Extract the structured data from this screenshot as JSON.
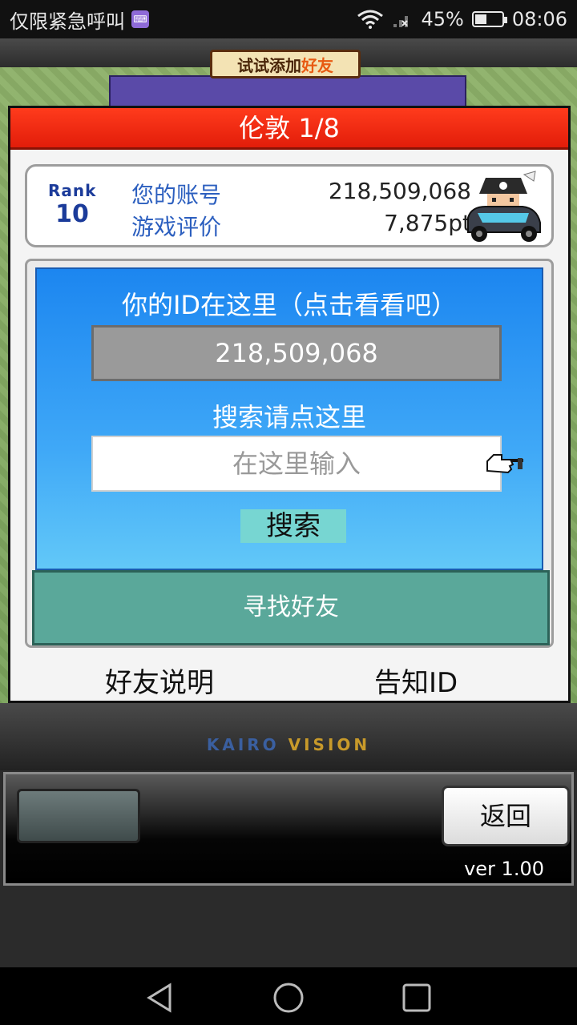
{
  "status_bar": {
    "carrier": "仅限紧急呼叫",
    "battery": "45%",
    "time": "08:06"
  },
  "background": {
    "banner_prefix": "试试添加",
    "banner_highlight": "好友"
  },
  "dialog": {
    "title": "伦敦 1/8",
    "rank_word": "Rank",
    "rank_value": "10",
    "account_label": "您的账号",
    "account_value": "218,509,068",
    "rating_label": "游戏评价",
    "rating_value": "7,875pt",
    "id_heading": "你的ID在这里（点击看看吧）",
    "id_value": "218,509,068",
    "search_heading": "搜索请点这里",
    "search_placeholder": "在这里输入",
    "search_button": "搜索",
    "find_friends_button": "寻找好友",
    "friend_help_link": "好友说明",
    "share_id_link": "告知ID"
  },
  "footer": {
    "logo_part1": "KAIRO",
    "logo_part2": "VISION",
    "back_button": "返回",
    "version": "ver 1.00"
  },
  "colors": {
    "title_red": "#e21d0a",
    "panel_blue": "#1c86f0",
    "find_button_teal": "#5aa89a",
    "search_button_cyan": "#77d6d2"
  }
}
